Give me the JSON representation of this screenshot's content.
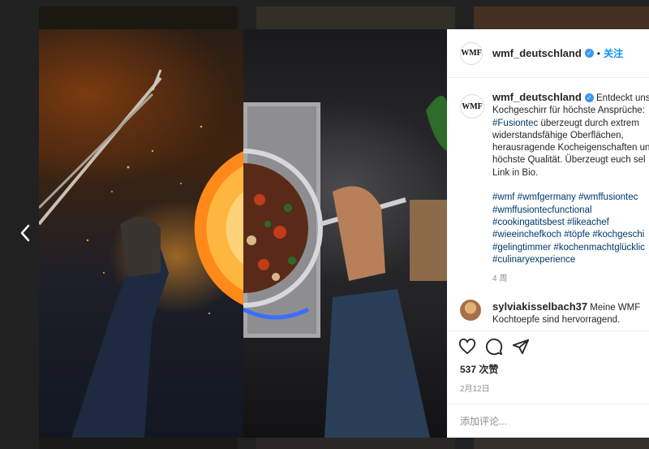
{
  "post": {
    "username": "wmf_deutschland",
    "logo_text": "WMF",
    "follow_label": "关注",
    "header_separator": "•",
    "caption_lines": [
      "Entdeckt unser",
      "Kochgeschirr für höchste Ansprüche:",
      "#Fusiontec",
      " überzeugt durch extrem",
      "widerstandsfähige Oberflächen,",
      "herausragende Kocheigenschaften un",
      "höchste Qualität. Überzeugt euch sel",
      "Link in Bio."
    ],
    "hashtag_lines": [
      "#wmf #wmfgermany #wmffusiontec",
      "#wmffusiontecfunctional",
      "#cookingatitsbest #likeachef",
      "#wieeinchefkoch #töpfe #kochgeschi",
      "#gelingtimmer #kochenmachtglücklic",
      "#culinaryexperience"
    ],
    "time_ago": "4 周",
    "comment": {
      "username": "sylviakisselbach37",
      "text_1": " Meine WMF",
      "text_2": "Kochtoepfe sind hervorragend."
    },
    "likes": "537 次赞",
    "date": "2月12日",
    "add_comment_placeholder": "添加评论..."
  },
  "icons": {
    "like": "heart-icon",
    "comment": "comment-icon",
    "share": "share-icon",
    "prev": "chevron-left-icon",
    "verified": "verified-badge-icon"
  },
  "colors": {
    "link": "#00376b",
    "follow": "#0095f6",
    "verified": "#3897f0",
    "muted": "#8e8e8e"
  }
}
